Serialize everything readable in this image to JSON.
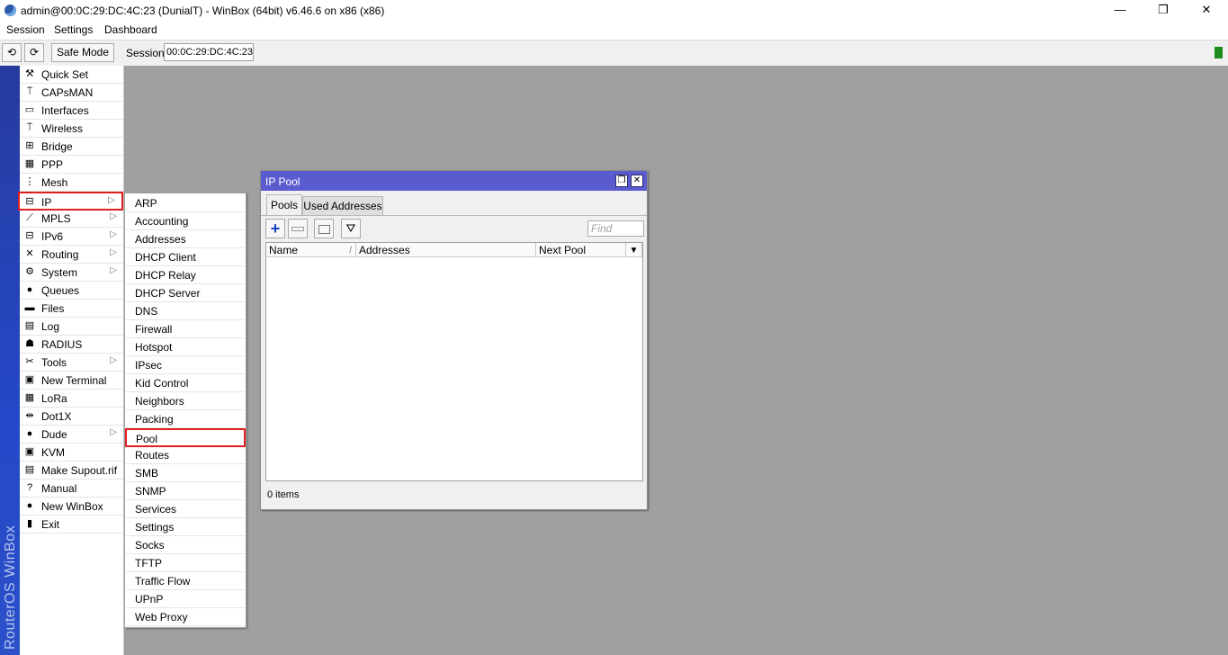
{
  "window": {
    "title": "admin@00:0C:29:DC:4C:23 (DunialT) - WinBox (64bit) v6.46.6 on x86 (x86)",
    "minimize": "—",
    "restore": "❐",
    "close": "✕"
  },
  "menubar": {
    "items": [
      "Session",
      "Settings",
      "Dashboard"
    ]
  },
  "toolbar": {
    "undo_icon": "⟲",
    "redo_icon": "⟳",
    "safe_mode": "Safe Mode",
    "session_label": "Session:",
    "session_value": "00:0C:29:DC:4C:23",
    "status_color": "#1e8b1e"
  },
  "vertical_brand": "RouterOS WinBox",
  "sidebar": {
    "items": [
      {
        "label": "Quick Set",
        "icon": "quickset-icon",
        "glyph": "⚒",
        "submenu": false
      },
      {
        "label": "CAPsMAN",
        "icon": "capsman-icon",
        "glyph": "⍑",
        "submenu": false
      },
      {
        "label": "Interfaces",
        "icon": "interfaces-icon",
        "glyph": "▭",
        "submenu": false
      },
      {
        "label": "Wireless",
        "icon": "wireless-icon",
        "glyph": "⍑",
        "submenu": false
      },
      {
        "label": "Bridge",
        "icon": "bridge-icon",
        "glyph": "⊞",
        "submenu": false
      },
      {
        "label": "PPP",
        "icon": "ppp-icon",
        "glyph": "▦",
        "submenu": false
      },
      {
        "label": "Mesh",
        "icon": "mesh-icon",
        "glyph": "⋮",
        "submenu": false
      },
      {
        "label": "IP",
        "icon": "ip-icon",
        "glyph": "⊟",
        "submenu": true,
        "selected": true
      },
      {
        "label": "MPLS",
        "icon": "mpls-icon",
        "glyph": "⟋",
        "submenu": true
      },
      {
        "label": "IPv6",
        "icon": "ipv6-icon",
        "glyph": "⊟",
        "submenu": true
      },
      {
        "label": "Routing",
        "icon": "routing-icon",
        "glyph": "✕",
        "submenu": true
      },
      {
        "label": "System",
        "icon": "system-icon",
        "glyph": "⚙",
        "submenu": true
      },
      {
        "label": "Queues",
        "icon": "queues-icon",
        "glyph": "●",
        "submenu": false
      },
      {
        "label": "Files",
        "icon": "files-icon",
        "glyph": "▬",
        "submenu": false
      },
      {
        "label": "Log",
        "icon": "log-icon",
        "glyph": "▤",
        "submenu": false
      },
      {
        "label": "RADIUS",
        "icon": "radius-icon",
        "glyph": "☗",
        "submenu": false
      },
      {
        "label": "Tools",
        "icon": "tools-icon",
        "glyph": "✂",
        "submenu": true
      },
      {
        "label": "New Terminal",
        "icon": "terminal-icon",
        "glyph": "▣",
        "submenu": false
      },
      {
        "label": "LoRa",
        "icon": "lora-icon",
        "glyph": "▦",
        "submenu": false
      },
      {
        "label": "Dot1X",
        "icon": "dot1x-icon",
        "glyph": "⇹",
        "submenu": false
      },
      {
        "label": "Dude",
        "icon": "dude-icon",
        "glyph": "●",
        "submenu": true
      },
      {
        "label": "KVM",
        "icon": "kvm-icon",
        "glyph": "▣",
        "submenu": false
      },
      {
        "label": "Make Supout.rif",
        "icon": "supout-icon",
        "glyph": "▤",
        "submenu": false
      },
      {
        "label": "Manual",
        "icon": "manual-icon",
        "glyph": "?",
        "submenu": false
      },
      {
        "label": "New WinBox",
        "icon": "winbox-icon",
        "glyph": "●",
        "submenu": false
      },
      {
        "label": "Exit",
        "icon": "exit-icon",
        "glyph": "▮",
        "submenu": false
      }
    ]
  },
  "ip_submenu": {
    "items": [
      "ARP",
      "Accounting",
      "Addresses",
      "DHCP Client",
      "DHCP Relay",
      "DHCP Server",
      "DNS",
      "Firewall",
      "Hotspot",
      "IPsec",
      "Kid Control",
      "Neighbors",
      "Packing",
      "Pool",
      "Routes",
      "SMB",
      "SNMP",
      "Services",
      "Settings",
      "Socks",
      "TFTP",
      "Traffic Flow",
      "UPnP",
      "Web Proxy"
    ],
    "selected": "Pool"
  },
  "ip_pool": {
    "title": "IP Pool",
    "restore_btn": "❐",
    "close_btn": "✕",
    "tabs": [
      {
        "label": "Pools",
        "active": true
      },
      {
        "label": "Used Addresses",
        "active": false
      }
    ],
    "find_placeholder": "Find",
    "columns": [
      "Name",
      "Addresses",
      "Next Pool"
    ],
    "sort_glyph": "/",
    "column_menu_glyph": "▼",
    "rows": [],
    "status": "0 items",
    "title_color": "#5b5bd0"
  }
}
